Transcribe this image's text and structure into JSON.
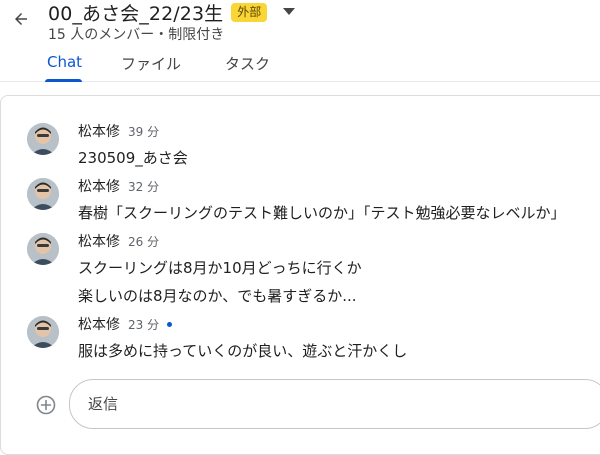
{
  "header": {
    "title": "00_あさ会_22/23生",
    "badge": "外部",
    "subtitle": "15 人のメンバー・制限付き"
  },
  "tabs": [
    {
      "label": "Chat",
      "active": true
    },
    {
      "label": "ファイル",
      "active": false
    },
    {
      "label": "タスク",
      "active": false
    }
  ],
  "messages": [
    {
      "sender": "松本修",
      "time": "39 分",
      "unread": false,
      "lines": [
        "230509_あさ会"
      ]
    },
    {
      "sender": "松本修",
      "time": "32 分",
      "unread": false,
      "lines": [
        "春樹「スクーリングのテスト難しいのか」「テスト勉強必要なレベルか」"
      ]
    },
    {
      "sender": "松本修",
      "time": "26 分",
      "unread": false,
      "lines": [
        "スクーリングは8月か10月どっちに行くか",
        "楽しいのは8月なのか、でも暑すぎるか..."
      ]
    },
    {
      "sender": "松本修",
      "time": "23 分",
      "unread": true,
      "lines": [
        "服は多めに持っていくのが良い、遊ぶと汗かくし"
      ]
    }
  ],
  "composer": {
    "placeholder": "返信",
    "value": ""
  },
  "colors": {
    "accent": "#0b57d0",
    "badge": "#f9d535"
  },
  "icons": [
    "arrow-back-icon",
    "dropdown-caret-icon",
    "avatar",
    "add-circle-icon"
  ]
}
